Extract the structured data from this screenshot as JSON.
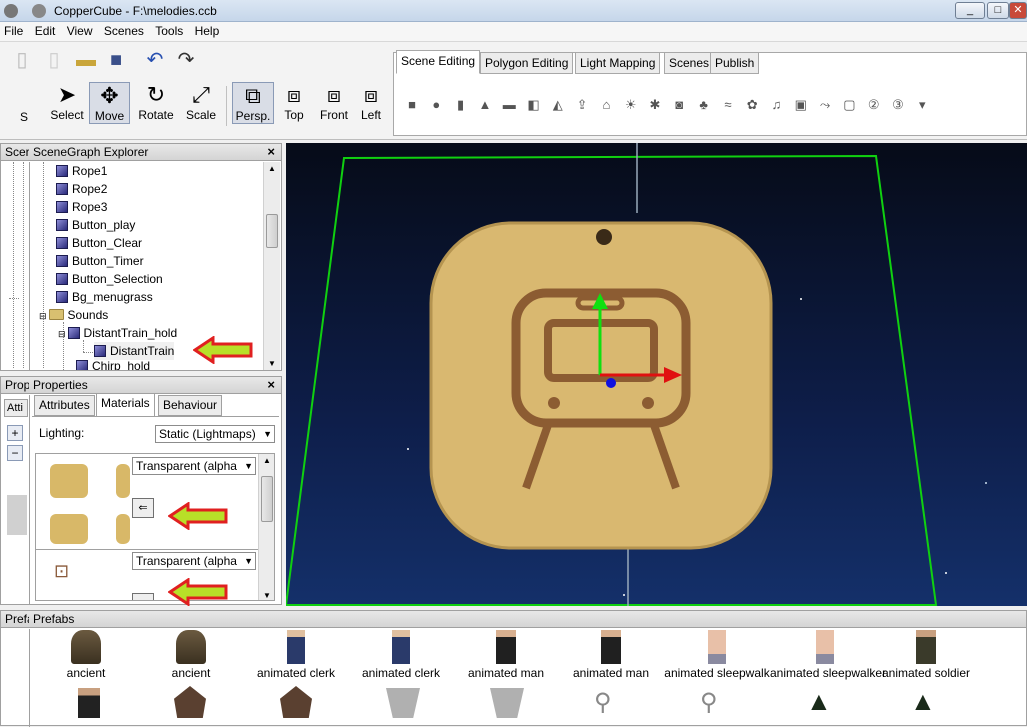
{
  "window": {
    "title": "CopperCube - F:\\melodies.ccb",
    "minimize": "_",
    "maximize": "□",
    "close": "✕"
  },
  "menu": [
    "File",
    "Edit",
    "View",
    "Scenes",
    "Tools",
    "Help"
  ],
  "toolbar": {
    "left_label": "S",
    "tools": [
      "Select",
      "Move",
      "Rotate",
      "Scale"
    ],
    "views": [
      "Persp.",
      "Top",
      "Front",
      "Left"
    ]
  },
  "tabs": [
    "Scene Editing",
    "Polygon Editing",
    "Light Mapping",
    "Scenes",
    "Publish"
  ],
  "scene_tools_icons": [
    "cube-icon",
    "sphere-icon",
    "cylinder-icon",
    "cone-icon",
    "plane-icon",
    "box-icon",
    "terrain-icon",
    "import-icon",
    "house-icon",
    "light-icon",
    "particle-icon",
    "camera-icon",
    "tree-icon",
    "water-icon",
    "skybox-icon",
    "sound-icon",
    "billboard-icon",
    "path-icon",
    "overlay-icon",
    "2d-icon",
    "3d-icon",
    "more-icon"
  ],
  "scenegraph": {
    "title": "SceneGraph Explorer",
    "collapsed_tab": "Scer",
    "items": [
      "Rope1",
      "Rope2",
      "Rope3",
      "Button_play",
      "Button_Clear",
      "Button_Timer",
      "Button_Selection",
      "Bg_menugrass",
      "Sounds",
      "DistantTrain_hold",
      "DistantTrain",
      "Chirp_hold"
    ]
  },
  "properties": {
    "title": "Properties",
    "collapsed_tab": "Prop",
    "collapsed_subtab": "Atti",
    "tabs": [
      "Attributes",
      "Materials",
      "Behaviour"
    ],
    "lighting_label": "Lighting:",
    "lighting_value": "Static (Lightmaps)",
    "material1_mode": "Transparent (alpha",
    "material2_mode": "Transparent (alpha"
  },
  "prefabs": {
    "title": "Prefabs",
    "collapsed_tab": "Prefa",
    "items": [
      "ancient",
      "ancient",
      "animated clerk",
      "animated clerk",
      "animated man",
      "animated man",
      "animated sleepwalk",
      "animated sleepwalker",
      "animated soldier"
    ]
  },
  "colors": {
    "accent_green": "#00e000",
    "annotation_red": "#e02020",
    "annotation_fill": "#b8e028"
  }
}
